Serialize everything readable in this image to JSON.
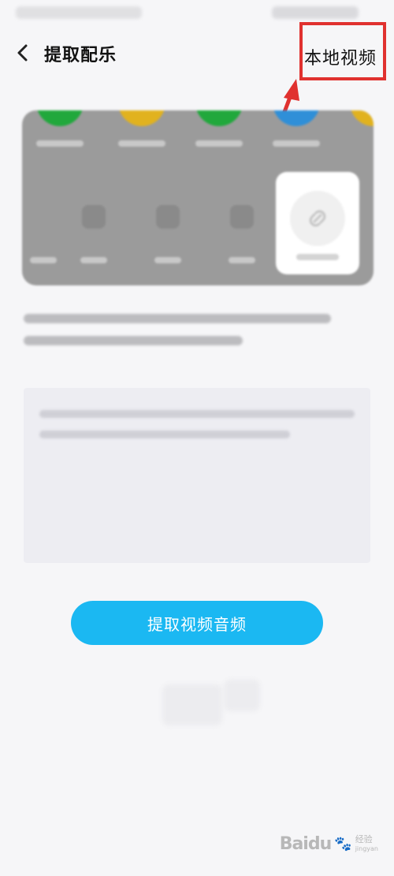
{
  "header": {
    "title": "提取配乐",
    "local_video_label": "本地视频"
  },
  "main": {
    "extract_button_label": "提取视频音频"
  },
  "annotation": {
    "highlight_color": "#e0312f"
  },
  "colors": {
    "accent": "#1bb8f2",
    "background": "#f6f6f8"
  },
  "watermark": {
    "brand": "Baidu",
    "sub": "经验",
    "sub2": "jingyan"
  }
}
